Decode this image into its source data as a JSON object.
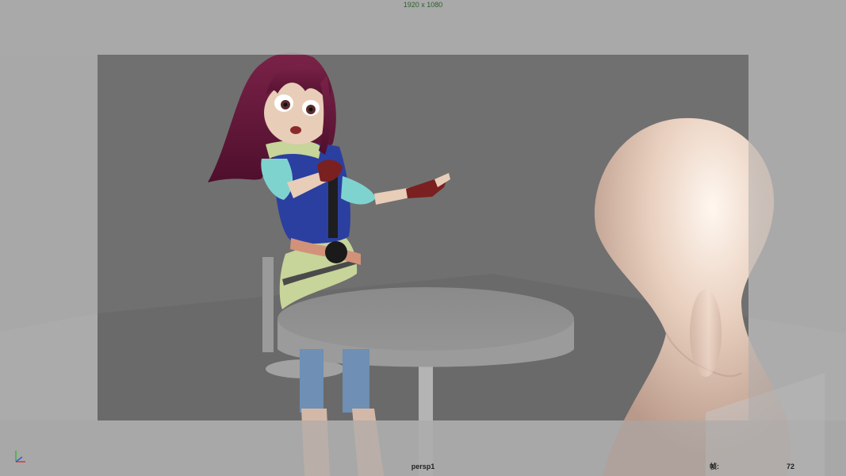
{
  "viewport": {
    "resolution_label": "1920 x 1080",
    "camera_name": "persp1",
    "frame_label": "帧:",
    "frame_value": "72"
  },
  "axis_gizmo": {
    "x_color": "#d23a3a",
    "y_color": "#3ab53a",
    "z_color": "#3a5ad2"
  },
  "colors": {
    "outer_bg": "#a9a9a9",
    "gate_bg": "#707070",
    "table_top": "#8f8f8f",
    "skin": "#e8cdb8",
    "hair": "#6b1a3a",
    "vest": "#2b3fa0",
    "sleeve": "#7fd3cf",
    "skirt": "#c7d49a",
    "jeans": "#6f8fb4"
  }
}
